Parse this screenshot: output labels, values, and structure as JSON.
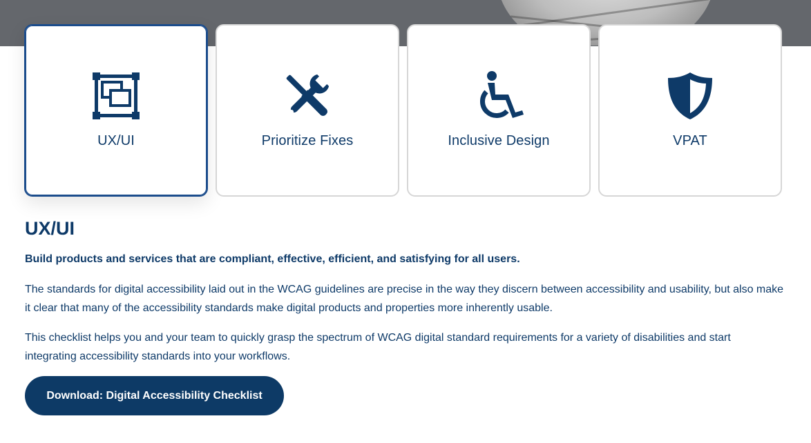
{
  "cards": [
    {
      "label": "UX/UI",
      "icon": "layers-frame-icon",
      "selected": true
    },
    {
      "label": "Prioritize Fixes",
      "icon": "tools-icon",
      "selected": false
    },
    {
      "label": "Inclusive Design",
      "icon": "wheelchair-icon",
      "selected": false
    },
    {
      "label": "VPAT",
      "icon": "shield-icon",
      "selected": false
    }
  ],
  "section": {
    "title": "UX/UI",
    "lead": "Build products and services that are compliant, effective, efficient, and satisfying for all users.",
    "paragraphs": [
      "The standards for digital accessibility laid out in the WCAG guidelines are precise in the way they discern between accessibility and usability, but also make it clear that many of the accessibility standards make digital products and properties more inherently usable.",
      "This checklist helps you and your team to quickly grasp the spectrum of WCAG digital standard requirements for a variety of disabilities and start integrating accessibility standards into your workflows."
    ],
    "button_label": "Download: Digital Accessibility Checklist"
  },
  "colors": {
    "brand_navy": "#0e3a68",
    "button_bg": "#0d3a66",
    "selected_border": "#1b4c8c",
    "card_border": "#d6d6d6",
    "hero_gray": "#64676c"
  }
}
